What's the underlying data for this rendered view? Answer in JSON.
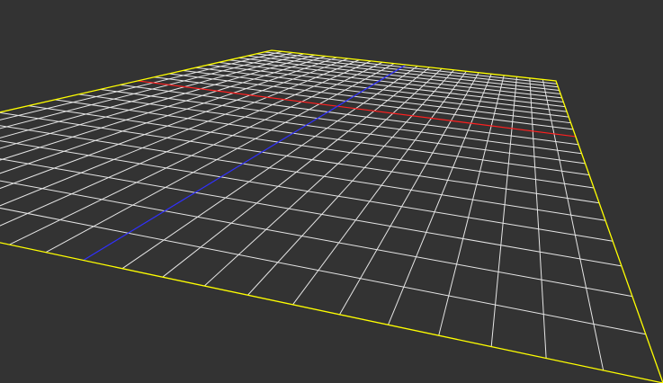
{
  "viewport": {
    "background_color": "#333333",
    "content": "3d-grid-floor-plane"
  },
  "grid": {
    "subdivisions": 24,
    "line_color": "#e6e6e6",
    "border_color": "#ffff00",
    "x_axis_color": "#ff2020",
    "z_axis_color": "#3030ff"
  }
}
